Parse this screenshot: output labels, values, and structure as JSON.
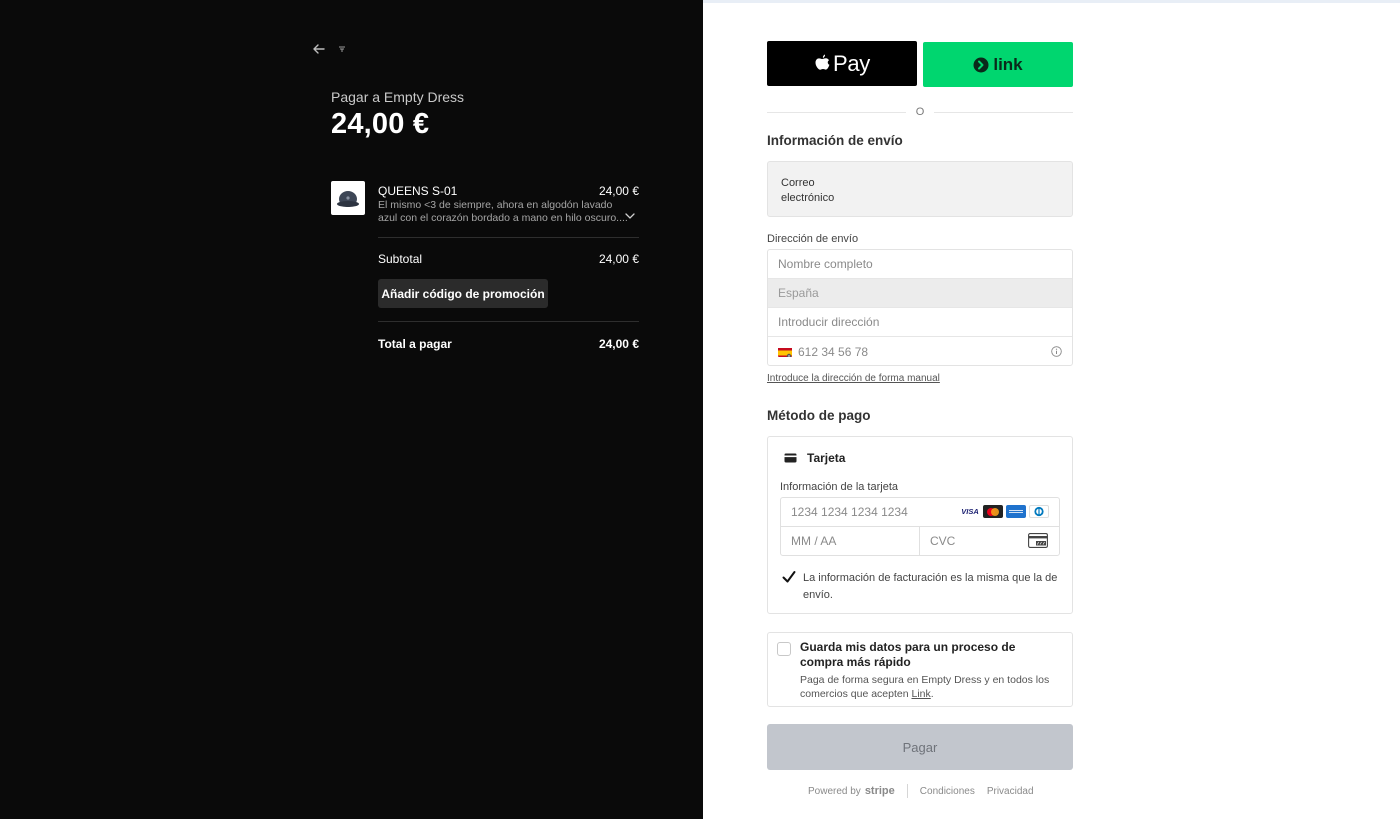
{
  "summary": {
    "merchant_line": "Pagar a Empty Dress",
    "total_big": "24,00 €",
    "item": {
      "name": "QUEENS S-01",
      "price": "24,00 €",
      "description": "El mismo <3 de siempre, ahora en algodón lavado azul con el corazón bordado a mano en hilo oscuro...."
    },
    "subtotal_label": "Subtotal",
    "subtotal_value": "24,00 €",
    "promo_label": "Añadir código de promoción",
    "total_label": "Total a pagar",
    "total_value": "24,00 €"
  },
  "wallets": {
    "applepay_label": "Pay",
    "link_label": "link"
  },
  "divider_or": "O",
  "shipping": {
    "title": "Información de envío",
    "email_label": "Correo electrónico",
    "address_label": "Dirección de envío",
    "name_placeholder": "Nombre completo",
    "country_value": "España",
    "address_placeholder": "Introducir dirección",
    "phone_placeholder": "612 34 56 78",
    "manual_link": "Introduce la dirección de forma manual"
  },
  "payment": {
    "title": "Método de pago",
    "card_title": "Tarjeta",
    "card_info_label": "Información de la tarjeta",
    "card_number_placeholder": "1234 1234 1234 1234",
    "expiry_placeholder": "MM / AA",
    "cvc_placeholder": "CVC",
    "brands": [
      "VISA",
      "mastercard",
      "amex",
      "diners"
    ],
    "billing_same_text": "La información de facturación es la misma que la de envío."
  },
  "save": {
    "title": "Guarda mis datos para un proceso de compra más rápido",
    "desc_prefix": "Paga de forma segura en Empty Dress y en todos los comercios que acepten ",
    "desc_link": "Link",
    "desc_suffix": "."
  },
  "pay_button": "Pagar",
  "footer": {
    "powered_by": "Powered by",
    "stripe": "stripe",
    "terms": "Condiciones",
    "privacy": "Privacidad"
  },
  "colors": {
    "left_bg": "#0a0a0a",
    "link_green": "#00d66f",
    "pay_disabled": "#c2c6cd"
  }
}
